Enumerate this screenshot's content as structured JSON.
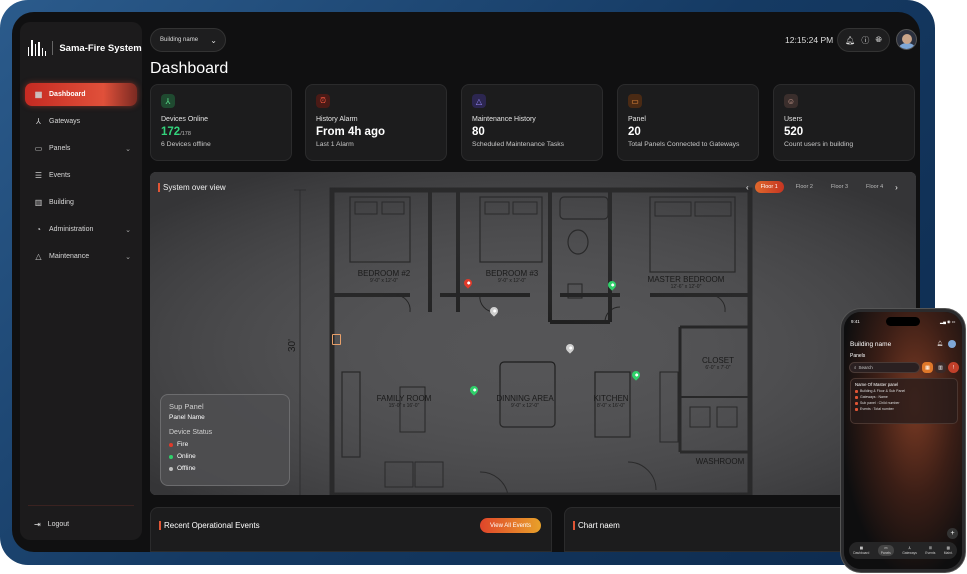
{
  "app": {
    "name": "Sama-Fire System"
  },
  "sidebar": {
    "items": [
      {
        "label": "Dashboard",
        "icon": "dashboard-icon"
      },
      {
        "label": "Gateways",
        "icon": "gateway-icon"
      },
      {
        "label": "Panels",
        "icon": "panel-icon"
      },
      {
        "label": "Events",
        "icon": "events-icon"
      },
      {
        "label": "Building",
        "icon": "building-icon"
      },
      {
        "label": "Administration",
        "icon": "admin-icon"
      },
      {
        "label": "Maintenance",
        "icon": "maintenance-icon"
      }
    ],
    "logout": "Logout"
  },
  "header": {
    "building_select": "Building name",
    "title": "Dashboard",
    "time": "12:15:24 PM"
  },
  "cards": [
    {
      "label": "Devices Online",
      "value": "172",
      "value_suffix": "/178",
      "sub": "6 Devices offline",
      "icon": "devices-icon",
      "color": "#2f7d4f"
    },
    {
      "label": "History Alarm",
      "value": "From 4h ago",
      "sub": "Last 1 Alarm",
      "icon": "alarm-icon",
      "color": "#7a2a22"
    },
    {
      "label": "Maintenance History",
      "value": "80",
      "sub": "Scheduled Maintenance Tasks",
      "icon": "maintenance-icon",
      "color": "#4b3f8f"
    },
    {
      "label": "Panel",
      "value": "20",
      "sub": "Total Panels Connected to Gateways",
      "icon": "panel-icon",
      "color": "#8a4a1e"
    },
    {
      "label": "Users",
      "value": "520",
      "sub": "Count users in building",
      "icon": "users-icon",
      "color": "#5a4a48"
    }
  ],
  "overview": {
    "title": "System over view",
    "floors": [
      "Floor 1",
      "Floor 2",
      "Floor 3",
      "Floor 4"
    ],
    "active_floor": "Floor 1",
    "rooms": [
      {
        "name": "BEDROOM #2",
        "size": "9'-0\" x 12'-0\""
      },
      {
        "name": "BEDROOM #3",
        "size": "9'-0\" x 12'-0\""
      },
      {
        "name": "MASTER BEDROOM",
        "size": "12'-6\" x 12'-0\""
      },
      {
        "name": "FAMILY ROOM",
        "size": "15'-0\" x 16'-0\""
      },
      {
        "name": "DINNING AREA",
        "size": "9'-0\" x 12'-0\""
      },
      {
        "name": "KITCHEN",
        "size": "8'-0\" x 16'-0\""
      },
      {
        "name": "CLOSET",
        "size": "6'-0\" x 7'-0\""
      },
      {
        "name": "WASHROOM",
        "size": ""
      }
    ],
    "dimension_label": "30'",
    "legend": {
      "title": "Sup Panel",
      "name": "Panel Name",
      "status_title": "Device Status",
      "statuses": [
        {
          "label": "Fire",
          "color": "#e03a2a"
        },
        {
          "label": "Online",
          "color": "#2fd06a"
        },
        {
          "label": "Offline",
          "color": "#bdbdbd"
        }
      ]
    }
  },
  "events": {
    "title": "Recent Operational Events",
    "button": "View All Events"
  },
  "chart": {
    "title": "Chart naem"
  },
  "phone": {
    "time": "9:41",
    "building": "Building name",
    "section": "Panels",
    "search_placeholder": "Search",
    "panel_name": "Name Of Master panel",
    "rows": [
      "Building & Floor & Sub Panel",
      "Gateways : Name",
      "Sub panel : Child number",
      "Events : Total number"
    ],
    "nav": [
      "Dashboard",
      "Panels",
      "Gateways",
      "Events",
      "Maint."
    ]
  }
}
